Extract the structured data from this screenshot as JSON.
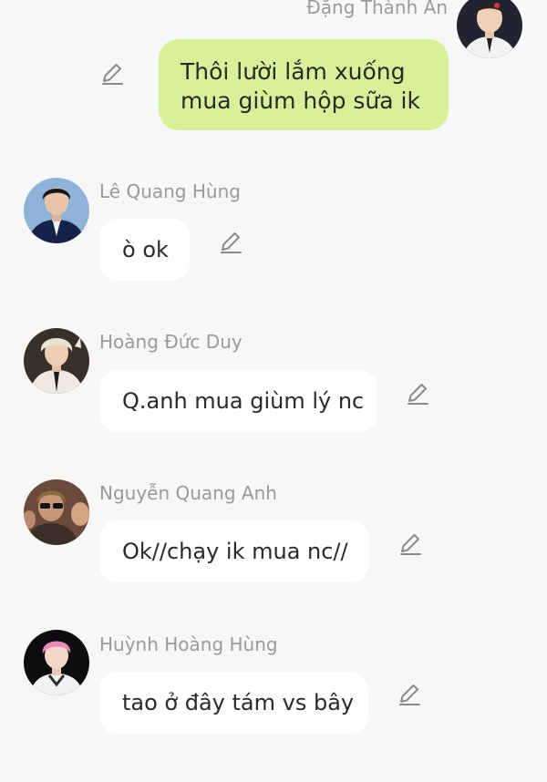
{
  "messages": [
    {
      "sender": "Đặng Thành An",
      "text": "Thôi lười lắm xuống\nmua giùm hộp sữa ik",
      "is_me": true,
      "avatar_icon": "avatar-boy-white-shirt"
    },
    {
      "sender": "Lê Quang Hùng",
      "text": "ò ok",
      "is_me": false,
      "avatar_icon": "avatar-boy-suit"
    },
    {
      "sender": "Hoàng Đức Duy",
      "text": "Q.anh mua giùm lý nc",
      "is_me": false,
      "avatar_icon": "avatar-blond-hair"
    },
    {
      "sender": "Nguyễn Quang Anh",
      "text": "Ok//chạy ik mua nc//",
      "is_me": false,
      "avatar_icon": "avatar-group-sunglasses"
    },
    {
      "sender": "Huỳnh Hoàng Hùng",
      "text": "tao ở đây tám vs bây",
      "is_me": false,
      "avatar_icon": "avatar-pink-hair"
    }
  ],
  "colors": {
    "background": "#f7f7f8",
    "my_bubble": "#d6f197",
    "other_bubble": "#ffffff",
    "name_text": "#9a9a9a",
    "message_text": "#2a2a2a",
    "edit_icon": "#8a8a8a"
  },
  "icons": {
    "edit": "pencil-edit-icon"
  }
}
